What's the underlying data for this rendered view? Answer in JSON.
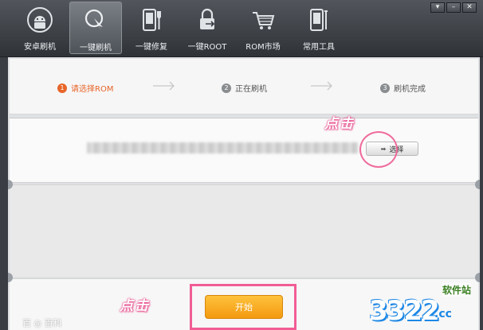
{
  "toolbar": {
    "items": [
      {
        "label": "安卓刷机",
        "icon": "android-icon"
      },
      {
        "label": "一键刷机",
        "icon": "flash-icon"
      },
      {
        "label": "一键修复",
        "icon": "repair-icon"
      },
      {
        "label": "一键ROOT",
        "icon": "root-lock-icon"
      },
      {
        "label": "ROM市场",
        "icon": "cart-icon"
      },
      {
        "label": "常用工具",
        "icon": "tools-icon"
      }
    ],
    "active_index": 1
  },
  "window_controls": {
    "options": "▾",
    "minimize": "–",
    "close": "✕"
  },
  "steps": [
    {
      "num": "1",
      "label": "请选择ROM",
      "state": "current"
    },
    {
      "num": "2",
      "label": "正在刷机",
      "state": "pending"
    },
    {
      "num": "3",
      "label": "刷机完成",
      "state": "pending"
    }
  ],
  "file_select": {
    "path_value": "",
    "choose_label": "选择",
    "choose_icon": "arrow-right-icon"
  },
  "start_button": {
    "label": "开始"
  },
  "annotations": {
    "note_top": "点击",
    "note_bottom": "点击"
  },
  "watermark": {
    "number": "3322",
    "suffix": ".cc",
    "site": "软件站",
    "corner": "百 ◎ 百科"
  },
  "colors": {
    "accent": "#e8652a",
    "start": "#f6a623",
    "annotation": "#f15d95"
  }
}
